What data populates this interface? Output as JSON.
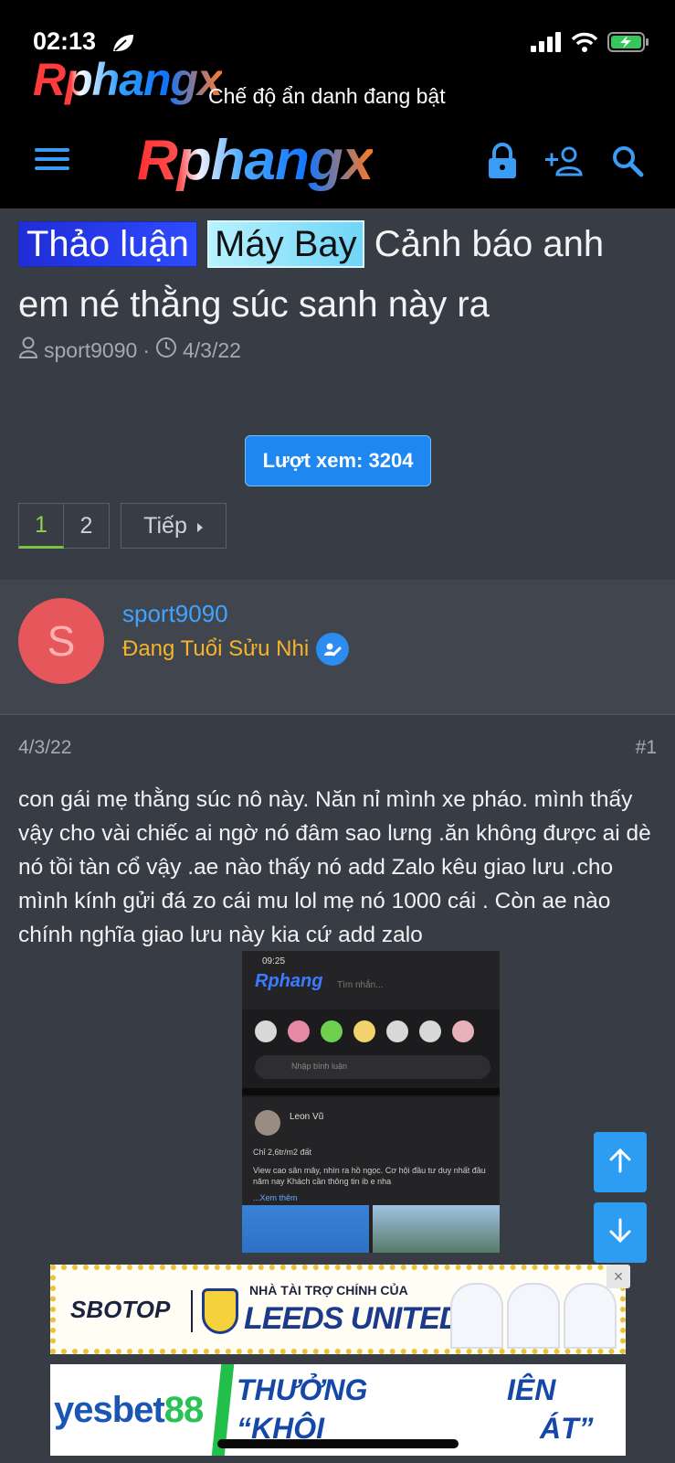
{
  "status_bar": {
    "time": "02:13"
  },
  "header": {
    "small_logo": "Rphangx",
    "incognito_text": "Chế độ ẩn danh đang bật",
    "logo": "Rphangx"
  },
  "thread": {
    "prefix_1": "Thảo luận",
    "prefix_2": "Máy Bay",
    "title": "Cảnh báo anh em né thằng súc sanh này ra",
    "author": "sport9090",
    "date": "4/3/22",
    "views_label": "Lượt xem: 3204"
  },
  "pagination": {
    "page_1": "1",
    "page_2": "2",
    "next": "Tiếp"
  },
  "post": {
    "avatar_letter": "S",
    "username": "sport9090",
    "user_title": "Đang Tuổi Sửu Nhi",
    "date": "4/3/22",
    "number": "#1",
    "body": "con gái mẹ thằng súc nô này. Năn nỉ mình xe pháo. mình thấy vậy cho vài chiếc ai ngờ nó đâm sao lưng .ăn không được ai dè nó tồi tàn cổ vậy .ae nào thấy nó add Zalo kêu giao lưu .cho mình kính gửi đá zo cái mu lol mẹ nó 1000 cái . Còn ae nào chính nghĩa giao lưu này kia cứ add zalo"
  },
  "embed": {
    "time": "09:25",
    "logo": "Rphang",
    "search": "Tìm nhắn...",
    "input_placeholder": "Nhập bình luận",
    "name": "Leon Vũ",
    "line_1": "Chỉ 2,6tr/m2 đất",
    "line_2": "View cao sân mây, nhìn ra hồ ngọc. Cơ hội đầu tư duy nhất đầu năm nay Khách cần thông tin ib e nha",
    "line_3": "...Xem thêm"
  },
  "ads": {
    "ad1_brand": "SBOTOP",
    "ad1_sponsor": "NHÀ TÀI TRỢ CHÍNH CỦA",
    "ad1_club": "LEEDS UNITED",
    "ad1_close": "×",
    "ad2_brand_a": "yesbet",
    "ad2_brand_b": "88",
    "ad2_line1": "THƯỞNG",
    "ad2_line2": "“KHÔI",
    "ad2_line3": "IÊN",
    "ad2_line4": "ÁT”"
  },
  "colors": {
    "accent": "#2d9cf3",
    "username": "#3fa4ff",
    "user_title": "#f4b52a",
    "page_active": "#7ac143"
  },
  "icons": [
    "leaf-icon",
    "signal-icon",
    "wifi-icon",
    "battery-icon",
    "menu-icon",
    "lock-icon",
    "add-user-icon",
    "search-icon",
    "user-icon",
    "clock-icon",
    "caret-right-icon",
    "verified-icon",
    "arrow-up-icon",
    "arrow-down-icon"
  ]
}
